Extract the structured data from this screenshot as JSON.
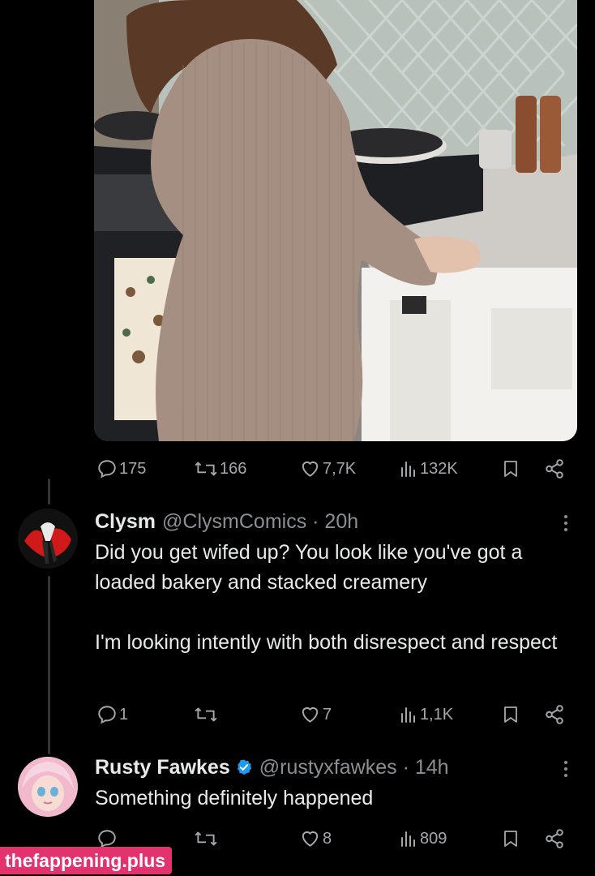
{
  "post": {
    "image": "photo-kitchen-knit-dress",
    "actions": {
      "replies": "175",
      "reposts": "166",
      "likes": "7,7K",
      "views": "132K"
    }
  },
  "replies": [
    {
      "name": "Clysm",
      "handle": "@ClysmComics",
      "time": "· 20h",
      "avatar": "clysm-avatar",
      "text": "Did you get wifed up? You look like you've got a loaded bakery and stacked creamery\n\nI'm looking intently with both disrespect and respect",
      "actions": {
        "replies": "1",
        "reposts": "",
        "likes": "7",
        "views": "1,1K"
      }
    },
    {
      "name": "Rusty Fawkes",
      "verified": true,
      "handle": "@rustyxfawkes",
      "time": "· 14h",
      "avatar": "rusty-avatar",
      "text": "Something definitely happened",
      "actions": {
        "replies": "",
        "reposts": "",
        "likes": "8",
        "views": "809"
      }
    }
  ],
  "watermark": "thefappening.plus",
  "colors": {
    "background": "#000000",
    "text": "#e7e9ea",
    "muted": "#8b8f94",
    "verified": "#1d9bf0",
    "watermark": "#e3336e"
  }
}
